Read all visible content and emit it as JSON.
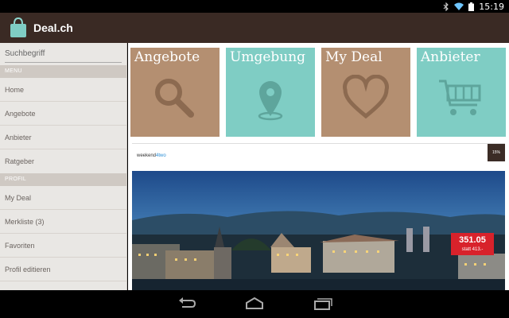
{
  "status_bar": {
    "time": "15:19"
  },
  "action_bar": {
    "title": "Deal.ch"
  },
  "sidebar": {
    "search_placeholder": "Suchbegriff",
    "menu_header": "MENU",
    "menu_items": [
      "Home",
      "Angebote",
      "Anbieter",
      "Ratgeber"
    ],
    "profile_header": "PROFIL",
    "profile_items": [
      "My Deal",
      "Merkliste (3)",
      "Favoriten",
      "Profil editieren"
    ]
  },
  "tiles": [
    {
      "label": "Angebote",
      "icon": "magnifier-icon",
      "color": "#b48f71"
    },
    {
      "label": "Umgebung",
      "icon": "map-pin-icon",
      "color": "#7fcdc4"
    },
    {
      "label": "My Deal",
      "icon": "heart-icon",
      "color": "#b48f71"
    },
    {
      "label": "Anbieter",
      "icon": "shopping-cart-icon",
      "color": "#7fcdc4"
    }
  ],
  "deal": {
    "logo_text": "weekend",
    "logo_accent": "4two",
    "corner_label": "15%",
    "price": "351.05",
    "old_price": "statt 413.-"
  },
  "colors": {
    "action_bar": "#3a2a24",
    "sidebar": "#e9e7e4",
    "price_badge": "#d8222b"
  }
}
